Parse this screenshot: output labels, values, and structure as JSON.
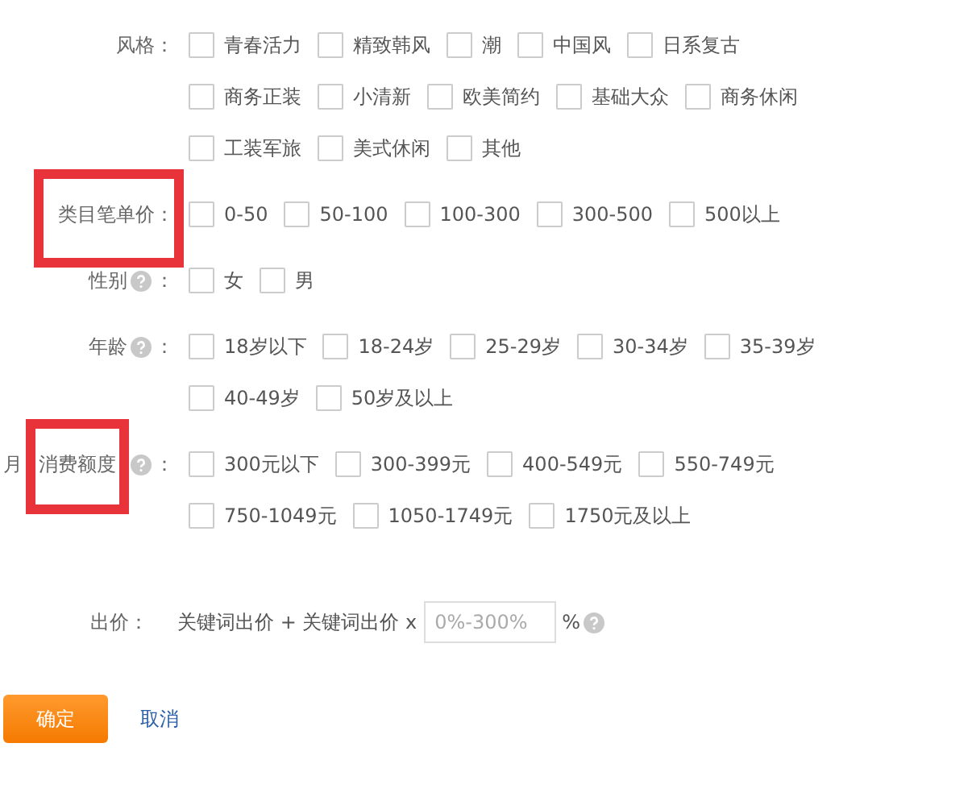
{
  "groups": [
    {
      "label_parts": [
        "风格"
      ],
      "help": false,
      "colon": "：",
      "highlighted": false,
      "lines": [
        [
          {
            "label": "青春活力",
            "checked": false
          },
          {
            "label": "精致韩风",
            "checked": false
          },
          {
            "label": "潮",
            "checked": false
          },
          {
            "label": "中国风",
            "checked": false
          },
          {
            "label": "日系复古",
            "checked": false
          }
        ],
        [
          {
            "label": "商务正装",
            "checked": false
          },
          {
            "label": "小清新",
            "checked": false
          },
          {
            "label": "欧美简约",
            "checked": false
          },
          {
            "label": "基础大众",
            "checked": false
          },
          {
            "label": "商务休闲",
            "checked": false
          }
        ],
        [
          {
            "label": "工装军旅",
            "checked": false
          },
          {
            "label": "美式休闲",
            "checked": false
          },
          {
            "label": "其他",
            "checked": false
          }
        ]
      ]
    },
    {
      "label_parts": [
        "类目笔单价"
      ],
      "help": false,
      "colon": "：",
      "highlighted": true,
      "lines": [
        [
          {
            "label": "0-50",
            "checked": false
          },
          {
            "label": "50-100",
            "checked": false
          },
          {
            "label": "100-300",
            "checked": false
          },
          {
            "label": "300-500",
            "checked": false
          },
          {
            "label": "500以上",
            "checked": false
          }
        ]
      ]
    },
    {
      "label_parts": [
        "性别"
      ],
      "help": true,
      "colon": "：",
      "highlighted": false,
      "lines": [
        [
          {
            "label": "女",
            "checked": false
          },
          {
            "label": "男",
            "checked": false
          }
        ]
      ]
    },
    {
      "label_parts": [
        "年龄"
      ],
      "help": true,
      "colon": "：",
      "highlighted": false,
      "lines": [
        [
          {
            "label": "18岁以下",
            "checked": false
          },
          {
            "label": "18-24岁",
            "checked": false
          },
          {
            "label": "25-29岁",
            "checked": false
          },
          {
            "label": "30-34岁",
            "checked": false
          },
          {
            "label": "35-39岁",
            "checked": false
          }
        ],
        [
          {
            "label": "40-49岁",
            "checked": false
          },
          {
            "label": "50岁及以上",
            "checked": false
          }
        ]
      ]
    },
    {
      "label_parts": [
        "月",
        "消费额度"
      ],
      "help": true,
      "colon": "：",
      "highlighted": true,
      "lines": [
        [
          {
            "label": "300元以下",
            "checked": false
          },
          {
            "label": "300-399元",
            "checked": false
          },
          {
            "label": "400-549元",
            "checked": false
          },
          {
            "label": "550-749元",
            "checked": false
          }
        ],
        [
          {
            "label": "750-1049元",
            "checked": false
          },
          {
            "label": "1050-1749元",
            "checked": false
          },
          {
            "label": "1750元及以上",
            "checked": false
          }
        ]
      ]
    }
  ],
  "bid": {
    "label": "出价：",
    "formula": "关键词出价 + 关键词出价 x",
    "placeholder": "0%-300%",
    "unit": "%",
    "help": true
  },
  "actions": {
    "confirm": "确定",
    "cancel": "取消"
  }
}
